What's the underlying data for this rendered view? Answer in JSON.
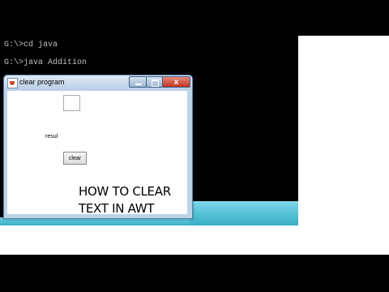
{
  "console": {
    "lines": [
      "G:\\>cd java",
      "G:\\>java Addition"
    ]
  },
  "window": {
    "title": "clear program",
    "close_symbol": "x",
    "text_field_value": "",
    "result_label": "resul",
    "clear_button_label": "clear"
  },
  "caption": {
    "line1": "HOW TO CLEAR",
    "line2": "TEXT IN AWT"
  },
  "icons": [
    "java-icon",
    "minimize-icon",
    "maximize-icon",
    "close-icon"
  ],
  "colors": {
    "console_bg": "#000000",
    "console_text": "#c0c0c0",
    "taskbar": "#3aafc9",
    "title_bar": "#b8cfe6",
    "close_button": "#c2321f"
  }
}
